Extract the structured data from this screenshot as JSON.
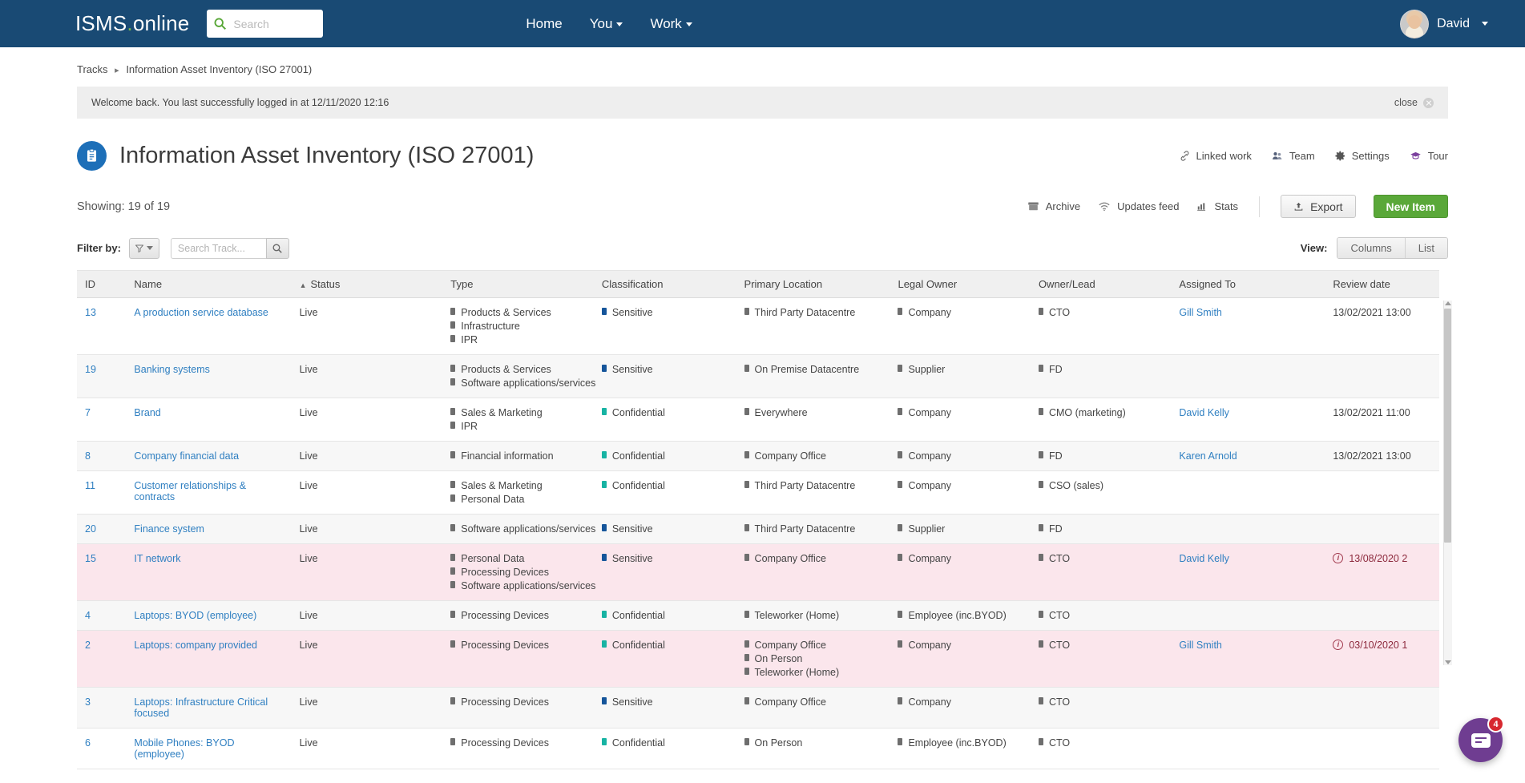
{
  "topbar": {
    "logo_main": "ISMS",
    "logo_dot": ".",
    "logo_sub": "online",
    "search_placeholder": "Search",
    "search_value": "",
    "nav": [
      {
        "label": "Home",
        "caret": false
      },
      {
        "label": "You",
        "caret": true
      },
      {
        "label": "Work",
        "caret": true
      }
    ],
    "user_name": "David"
  },
  "breadcrumb": {
    "root": "Tracks",
    "separator": "▸",
    "current": "Information Asset Inventory (ISO 27001)"
  },
  "notice": {
    "message": "Welcome back. You last successfully logged in at 12/11/2020 12:16",
    "close_label": "close"
  },
  "header": {
    "title": "Information Asset Inventory (ISO 27001)",
    "actions": [
      {
        "label": "Linked work",
        "icon": "link-icon"
      },
      {
        "label": "Team",
        "icon": "team-icon"
      },
      {
        "label": "Settings",
        "icon": "gear-icon"
      },
      {
        "label": "Tour",
        "icon": "graduation-cap-icon"
      }
    ]
  },
  "toolbar": {
    "showing": "Showing: 19 of 19",
    "tools": [
      {
        "label": "Archive",
        "icon": "archive-icon"
      },
      {
        "label": "Updates feed",
        "icon": "wifi-icon"
      },
      {
        "label": "Stats",
        "icon": "bar-chart-icon"
      }
    ],
    "export_label": "Export",
    "new_item_label": "New Item"
  },
  "filters": {
    "filter_by_label": "Filter by:",
    "search_placeholder": "Search Track...",
    "search_value": "",
    "view_label": "View:",
    "view_options": [
      "Columns",
      "List"
    ]
  },
  "table": {
    "columns": [
      "ID",
      "Name",
      "Status",
      "Type",
      "Classification",
      "Primary Location",
      "Legal Owner",
      "Owner/Lead",
      "Assigned To",
      "Review date"
    ],
    "sorted_column": "Name",
    "sort_direction": "asc",
    "rows": [
      {
        "id": "13",
        "name": "A production service database",
        "status": "Live",
        "type": [
          "Products & Services",
          "Infrastructure",
          "IPR"
        ],
        "classification": "Sensitive",
        "classification_color": "sensitive",
        "primary_location": [
          "Third Party Datacentre"
        ],
        "legal_owner": [
          "Company"
        ],
        "owner_lead": [
          "CTO"
        ],
        "assigned_to": "Gill Smith",
        "review_date": "13/02/2021 13:00",
        "overdue": false
      },
      {
        "id": "19",
        "name": "Banking systems",
        "status": "Live",
        "type": [
          "Products & Services",
          "Software applications/services"
        ],
        "classification": "Sensitive",
        "classification_color": "sensitive",
        "primary_location": [
          "On Premise Datacentre"
        ],
        "legal_owner": [
          "Supplier"
        ],
        "owner_lead": [
          "FD"
        ],
        "assigned_to": "",
        "review_date": "",
        "overdue": false
      },
      {
        "id": "7",
        "name": "Brand",
        "status": "Live",
        "type": [
          "Sales & Marketing",
          "IPR"
        ],
        "classification": "Confidential",
        "classification_color": "confidential",
        "primary_location": [
          "Everywhere"
        ],
        "legal_owner": [
          "Company"
        ],
        "owner_lead": [
          "CMO (marketing)"
        ],
        "assigned_to": "David Kelly",
        "review_date": "13/02/2021 11:00",
        "overdue": false
      },
      {
        "id": "8",
        "name": "Company financial data",
        "status": "Live",
        "type": [
          "Financial information"
        ],
        "classification": "Confidential",
        "classification_color": "confidential",
        "primary_location": [
          "Company Office"
        ],
        "legal_owner": [
          "Company"
        ],
        "owner_lead": [
          "FD"
        ],
        "assigned_to": "Karen Arnold",
        "review_date": "13/02/2021 13:00",
        "overdue": false
      },
      {
        "id": "11",
        "name": "Customer relationships & contracts",
        "status": "Live",
        "type": [
          "Sales & Marketing",
          "Personal Data"
        ],
        "classification": "Confidential",
        "classification_color": "confidential",
        "primary_location": [
          "Third Party Datacentre"
        ],
        "legal_owner": [
          "Company"
        ],
        "owner_lead": [
          "CSO (sales)"
        ],
        "assigned_to": "",
        "review_date": "",
        "overdue": false
      },
      {
        "id": "20",
        "name": "Finance system",
        "status": "Live",
        "type": [
          "Software applications/services"
        ],
        "classification": "Sensitive",
        "classification_color": "sensitive",
        "primary_location": [
          "Third Party Datacentre"
        ],
        "legal_owner": [
          "Supplier"
        ],
        "owner_lead": [
          "FD"
        ],
        "assigned_to": "",
        "review_date": "",
        "overdue": false
      },
      {
        "id": "15",
        "name": "IT network",
        "status": "Live",
        "type": [
          "Personal Data",
          "Processing Devices",
          "Software applications/services"
        ],
        "classification": "Sensitive",
        "classification_color": "sensitive",
        "primary_location": [
          "Company Office"
        ],
        "legal_owner": [
          "Company"
        ],
        "owner_lead": [
          "CTO"
        ],
        "assigned_to": "David Kelly",
        "review_date": "13/08/2020 2",
        "overdue": true
      },
      {
        "id": "4",
        "name": "Laptops: BYOD (employee)",
        "status": "Live",
        "type": [
          "Processing Devices"
        ],
        "classification": "Confidential",
        "classification_color": "confidential",
        "primary_location": [
          "Teleworker (Home)"
        ],
        "legal_owner": [
          "Employee (inc.BYOD)"
        ],
        "owner_lead": [
          "CTO"
        ],
        "assigned_to": "",
        "review_date": "",
        "overdue": false
      },
      {
        "id": "2",
        "name": "Laptops: company provided",
        "status": "Live",
        "type": [
          "Processing Devices"
        ],
        "classification": "Confidential",
        "classification_color": "confidential",
        "primary_location": [
          "Company Office",
          "On Person",
          "Teleworker (Home)"
        ],
        "legal_owner": [
          "Company"
        ],
        "owner_lead": [
          "CTO"
        ],
        "assigned_to": "Gill Smith",
        "review_date": "03/10/2020 1",
        "overdue": true
      },
      {
        "id": "3",
        "name": "Laptops: Infrastructure Critical focused",
        "status": "Live",
        "type": [
          "Processing Devices"
        ],
        "classification": "Sensitive",
        "classification_color": "sensitive",
        "primary_location": [
          "Company Office"
        ],
        "legal_owner": [
          "Company"
        ],
        "owner_lead": [
          "CTO"
        ],
        "assigned_to": "",
        "review_date": "",
        "overdue": false
      },
      {
        "id": "6",
        "name": "Mobile Phones: BYOD (employee)",
        "status": "Live",
        "type": [
          "Processing Devices"
        ],
        "classification": "Confidential",
        "classification_color": "confidential",
        "primary_location": [
          "On Person"
        ],
        "legal_owner": [
          "Employee (inc.BYOD)"
        ],
        "owner_lead": [
          "CTO"
        ],
        "assigned_to": "",
        "review_date": "",
        "overdue": false
      }
    ]
  },
  "chat": {
    "badge_count": "4"
  },
  "colors": {
    "nav_blue": "#194a74",
    "green": "#5aa839",
    "link_blue": "#2f7fc1",
    "sensitive": "#15559a",
    "confidential": "#17b3a3",
    "overdue_bg": "#fbe6ec",
    "overdue_text": "#8d2a3d",
    "chat_purple": "#6f3d91",
    "badge_red": "#d7282f"
  }
}
